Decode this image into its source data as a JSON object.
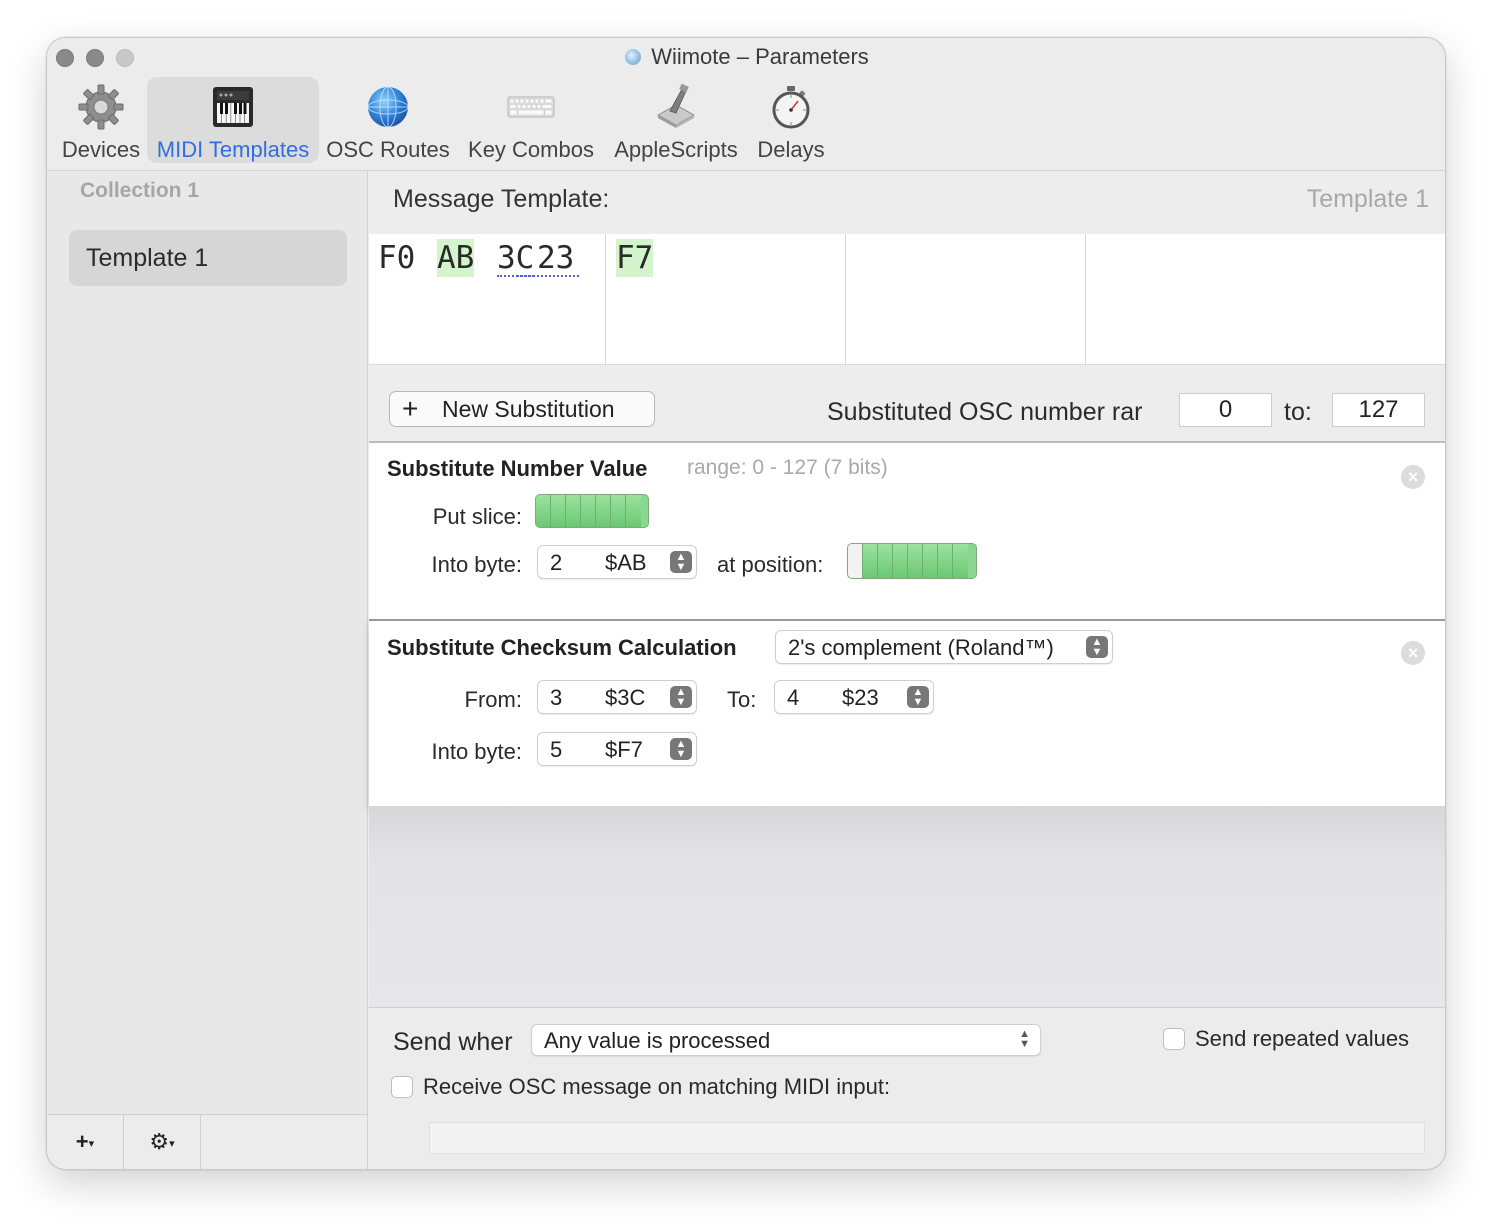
{
  "window": {
    "title": "Wiimote – Parameters"
  },
  "toolbar": {
    "items": [
      {
        "label": "Devices",
        "icon": "gear-icon"
      },
      {
        "label": "MIDI Templates",
        "icon": "piano-icon",
        "selected": true
      },
      {
        "label": "OSC Routes",
        "icon": "globe-icon"
      },
      {
        "label": "Key Combos",
        "icon": "keyboard-icon"
      },
      {
        "label": "AppleScripts",
        "icon": "applescript-icon"
      },
      {
        "label": "Delays",
        "icon": "stopwatch-icon"
      }
    ],
    "selected_color": "#2f6fe0"
  },
  "sidebar": {
    "header": "Collection 1",
    "items": [
      {
        "label": "Template 1",
        "selected": true
      }
    ],
    "footer": {
      "add_label": "+",
      "gear_label": "⚙"
    }
  },
  "template": {
    "heading": "Message Template:",
    "name": "Template 1",
    "bytes": [
      {
        "text": "F0",
        "style": "plain"
      },
      {
        "text": "AB",
        "style": "substituted"
      },
      {
        "text": "3C",
        "style": "checksum-range"
      },
      {
        "text": "23",
        "style": "checksum-range"
      },
      {
        "text": "F7",
        "style": "substituted"
      }
    ]
  },
  "substitution_bar": {
    "new_button": "New Substitution",
    "range_label": "Substituted OSC number rar",
    "range_from": "0",
    "to_label": "to:",
    "range_to": "127"
  },
  "number_value": {
    "title": "Substitute Number Value",
    "range_text": "range: 0 - 127 (7 bits)",
    "put_slice_label": "Put slice:",
    "into_byte_label": "Into byte:",
    "into_byte_index": "2",
    "into_byte_hex": "$AB",
    "at_position_label": "at position:"
  },
  "checksum": {
    "title": "Substitute Checksum Calculation",
    "method": "2's complement (Roland™)",
    "from_label": "From:",
    "from_index": "3",
    "from_hex": "$3C",
    "to_label": "To:",
    "to_index": "4",
    "to_hex": "$23",
    "into_byte_label": "Into byte:",
    "into_index": "5",
    "into_hex": "$F7"
  },
  "send": {
    "when_label": "Send wher",
    "when_value": "Any value is processed",
    "repeated_label": "Send repeated values",
    "repeated_checked": false,
    "receive_label": "Receive OSC message on matching MIDI input:",
    "receive_checked": false,
    "osc_value": ""
  },
  "colors": {
    "green_highlight": "#d4f5cc",
    "bit_green": "#8ad88f"
  }
}
